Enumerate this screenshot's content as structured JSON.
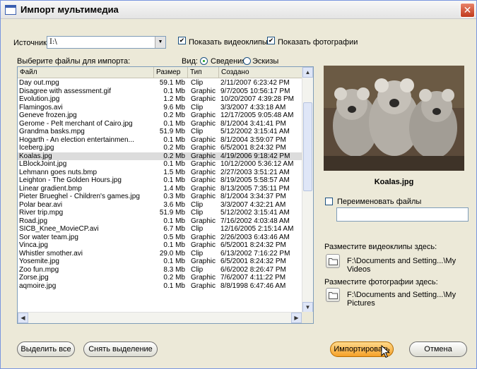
{
  "window": {
    "title": "Импорт мультимедиа",
    "close_glyph": "✕"
  },
  "source": {
    "label": "Источник:",
    "value": "I:\\",
    "arrow": "▼"
  },
  "options": {
    "show_clips_label": "Показать видеоклипы",
    "show_clips_checked": true,
    "show_photos_label": "Показать фотографии",
    "show_photos_checked": true,
    "check_glyph": "✔"
  },
  "list": {
    "label": "Выберите файлы для импорта:",
    "view_label": "Вид:",
    "view_details": "Сведения",
    "view_thumbs": "Эскизы",
    "view_selected": "details",
    "columns": [
      "Файл",
      "Размер",
      "Тип",
      "Создано"
    ],
    "rows": [
      [
        "Day out.mpg",
        "59.1 Mb",
        "Clip",
        "2/11/2007 6:23:42 PM"
      ],
      [
        "Disagree with assessment.gif",
        "0.1 Mb",
        "Graphic",
        "9/7/2005 10:56:17 PM"
      ],
      [
        "Evolution.jpg",
        "1.2 Mb",
        "Graphic",
        "10/20/2007 4:39:28 PM"
      ],
      [
        "Flamingos.avi",
        "9.6 Mb",
        "Clip",
        "3/3/2007 4:33:18 AM"
      ],
      [
        "Geneve frozen.jpg",
        "0.2 Mb",
        "Graphic",
        "12/17/2005 9:05:48 AM"
      ],
      [
        "Gerome - Pelt merchant of Cairo.jpg",
        "0.1 Mb",
        "Graphic",
        "8/1/2004 3:41:41 PM"
      ],
      [
        "Grandma basks.mpg",
        "51.9 Mb",
        "Clip",
        "5/12/2002 3:15:41 AM"
      ],
      [
        "Hogarth - An election entertainmen...",
        "0.1 Mb",
        "Graphic",
        "8/1/2004 3:59:07 PM"
      ],
      [
        "Iceberg.jpg",
        "0.2 Mb",
        "Graphic",
        "6/5/2001 8:24:32 PM"
      ],
      [
        "Koalas.jpg",
        "0.2 Mb",
        "Graphic",
        "4/19/2006 9:18:42 PM"
      ],
      [
        "LBlockJoint.jpg",
        "0.1 Mb",
        "Graphic",
        "10/12/2000 5:36:12 AM"
      ],
      [
        "Lehmann goes nuts.bmp",
        "1.5 Mb",
        "Graphic",
        "2/27/2003 3:51:21 AM"
      ],
      [
        "Leighton - The Golden Hours.jpg",
        "0.1 Mb",
        "Graphic",
        "8/19/2005 5:58:57 AM"
      ],
      [
        "Linear gradient.bmp",
        "1.4 Mb",
        "Graphic",
        "8/13/2005 7:35:11 PM"
      ],
      [
        "Pieter Brueghel - Children's games.jpg",
        "0.3 Mb",
        "Graphic",
        "8/1/2004 3:34:37 PM"
      ],
      [
        "Polar bear.avi",
        "3.6 Mb",
        "Clip",
        "3/3/2007 4:32:21 AM"
      ],
      [
        "River trip.mpg",
        "51.9 Mb",
        "Clip",
        "5/12/2002 3:15:41 AM"
      ],
      [
        "Road.jpg",
        "0.1 Mb",
        "Graphic",
        "7/16/2002 4:03:48 AM"
      ],
      [
        "SICB_Knee_MovieCP.avi",
        "6.7 Mb",
        "Clip",
        "12/16/2005 2:15:14 AM"
      ],
      [
        "Sor water team.jpg",
        "0.5 Mb",
        "Graphic",
        "2/26/2003 6:43:46 AM"
      ],
      [
        "Vinca.jpg",
        "0.1 Mb",
        "Graphic",
        "6/5/2001 8:24:32 PM"
      ],
      [
        "Whistler smother.avi",
        "29.0 Mb",
        "Clip",
        "6/13/2002 7:16:22 PM"
      ],
      [
        "Yosemite.jpg",
        "0.1 Mb",
        "Graphic",
        "6/5/2001 8:24:32 PM"
      ],
      [
        "Zoo fun.mpg",
        "8.3 Mb",
        "Clip",
        "6/6/2002 8:26:47 PM"
      ],
      [
        "Zorse.jpg",
        "0.2 Mb",
        "Graphic",
        "7/6/2007 4:11:22 PM"
      ],
      [
        "aqmoire.jpg",
        "0.1 Mb",
        "Graphic",
        "8/8/1998 6:47:46 AM"
      ]
    ],
    "selected_index": 9,
    "scroll": {
      "up": "▲",
      "down": "▼",
      "left": "◀",
      "right": "▶"
    }
  },
  "preview": {
    "caption": "Koalas.jpg"
  },
  "rename": {
    "label": "Переименовать файлы",
    "checked": false,
    "value": ""
  },
  "clips_dest": {
    "label": "Разместите видеоклипы здесь:",
    "path": "F:\\Documents and Setting...\\My Videos"
  },
  "photos_dest": {
    "label": "Разместите фотографии здесь:",
    "path": "F:\\Documents and Setting...\\My Pictures"
  },
  "buttons": {
    "select_all": "Выделить все",
    "deselect": "Снять выделение",
    "import": "Импортировать",
    "cancel": "Отмена"
  },
  "colors": {
    "import_button": "#f5a12a",
    "close_button": "#c0391c",
    "selected_row": "#dcdcdc"
  }
}
